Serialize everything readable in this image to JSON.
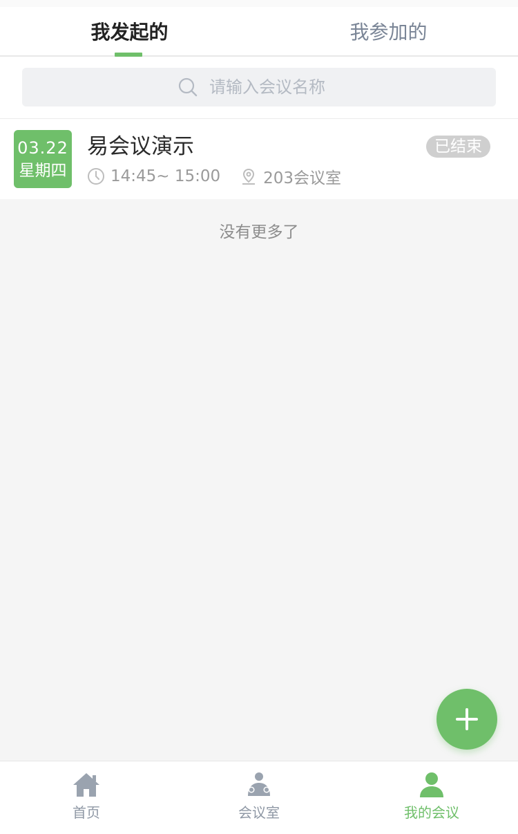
{
  "tabs": [
    {
      "label": "我发起的",
      "active": true
    },
    {
      "label": "我参加的",
      "active": false
    }
  ],
  "search": {
    "placeholder": "请输入会议名称",
    "value": ""
  },
  "meetings": [
    {
      "date": "03.22",
      "weekday": "星期四",
      "title": "易会议演示",
      "time": "14:45~ 15:00",
      "room": "203会议室",
      "status": "已结束"
    }
  ],
  "list_end_text": "没有更多了",
  "fab": {
    "icon": "plus-icon"
  },
  "tabbar": [
    {
      "label": "首页",
      "icon": "home-icon",
      "active": false
    },
    {
      "label": "会议室",
      "icon": "meeting-room-icon",
      "active": false
    },
    {
      "label": "我的会议",
      "icon": "user-icon",
      "active": true
    }
  ],
  "colors": {
    "accent": "#6fbf6a",
    "inactive": "#8f98a5",
    "status_bg": "#cfcfcf"
  }
}
